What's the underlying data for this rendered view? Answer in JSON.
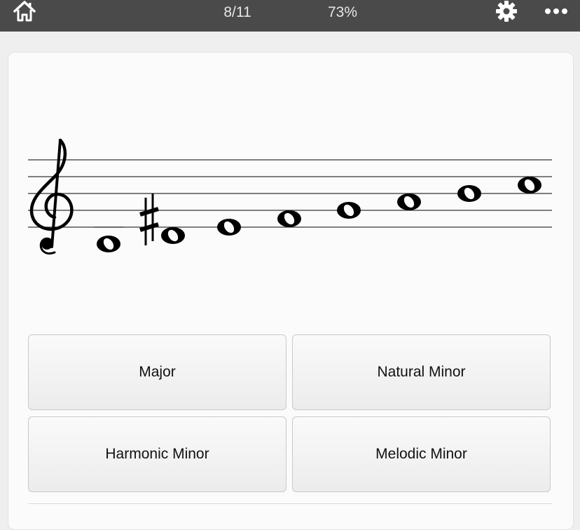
{
  "topbar": {
    "progress": "8/11",
    "score": "73%",
    "home_icon": "home-icon",
    "settings_icon": "gear-icon",
    "more_icon": "more-dots-icon",
    "background": "#4a4a4a"
  },
  "staff": {
    "clef": "treble",
    "notes": [
      "C4",
      "D#4",
      "E4",
      "F4",
      "G4",
      "A4",
      "B4",
      "C5"
    ],
    "accidentals": [
      "",
      "sharp",
      "",
      "",
      "",
      "",
      "",
      ""
    ]
  },
  "answers": [
    {
      "label": "Major"
    },
    {
      "label": "Natural Minor"
    },
    {
      "label": "Harmonic Minor"
    },
    {
      "label": "Melodic Minor"
    }
  ]
}
